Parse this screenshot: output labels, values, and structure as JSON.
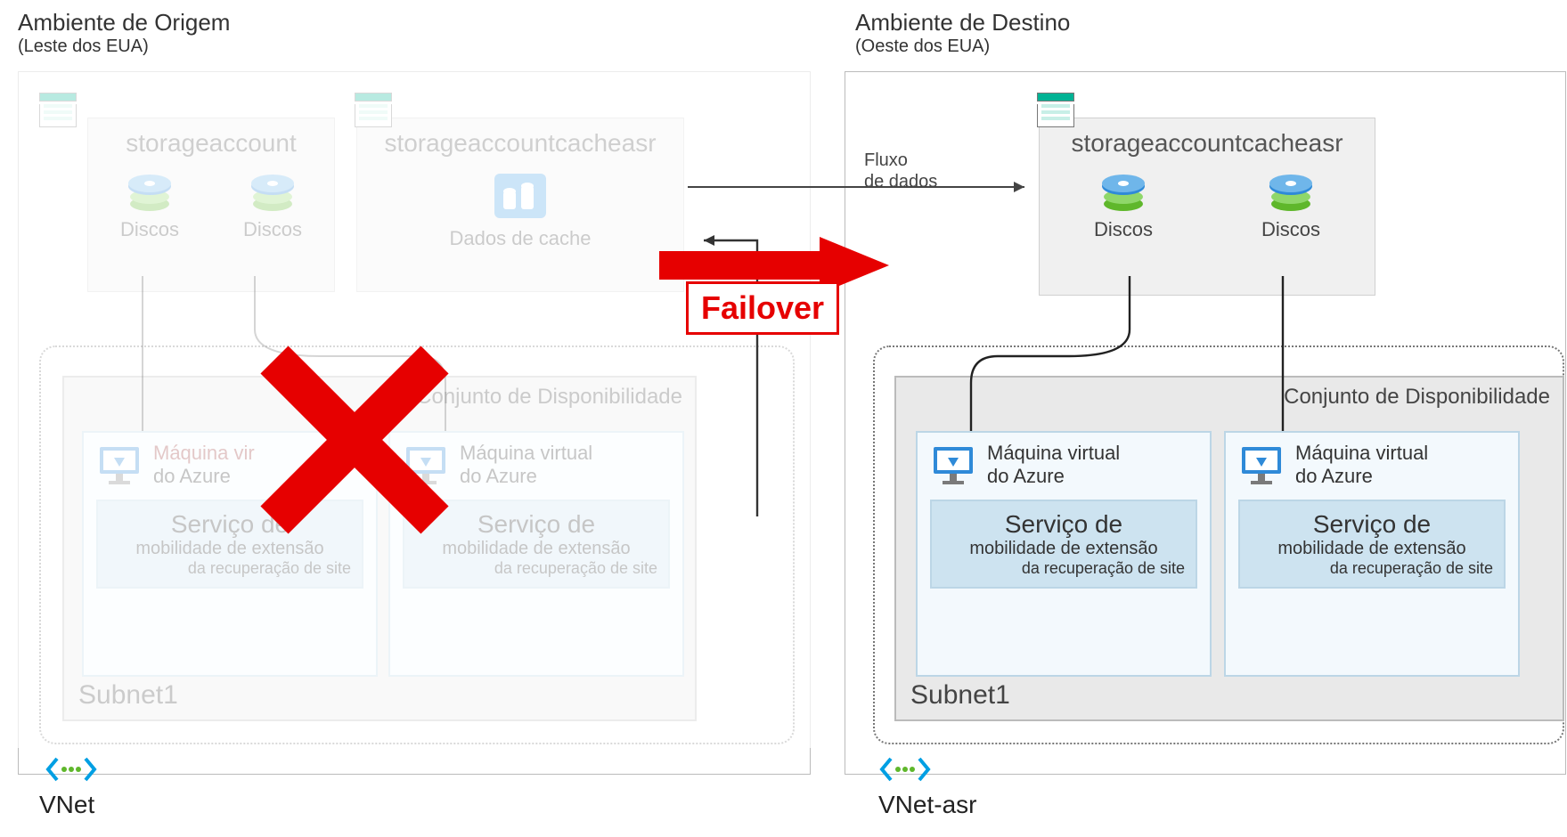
{
  "source": {
    "title": "Ambiente de Origem",
    "subtitle": "(Leste dos EUA)",
    "storage1": {
      "title": "storageaccount",
      "disk_label": "Discos"
    },
    "storage2": {
      "title": "storageaccountcacheasr",
      "cache_label": "Dados de cache"
    },
    "vnet": {
      "label": "VNet",
      "availability_title": "Conjunto de Disponibilidade",
      "subnet_label": "Subnet1",
      "vm_title_line1": "Máquina virtual",
      "vm_title_line1_cut": "Máquina vir",
      "vm_title_line2": "do Azure",
      "service_line1": "Serviço de",
      "service_line2": "mobilidade de extensão",
      "service_line3": "da recuperação de site"
    }
  },
  "target": {
    "title": "Ambiente de Destino",
    "subtitle": "(Oeste dos EUA)",
    "storage": {
      "title": "storageaccountcacheasr",
      "disk_label": "Discos"
    },
    "vnet": {
      "label": "VNet-asr",
      "availability_title": "Conjunto de Disponibilidade",
      "subnet_label": "Subnet1",
      "vm_title_line1": "Máquina virtual",
      "vm_title_line2": "do Azure",
      "service_line1": "Serviço de",
      "service_line2": "mobilidade de extensão",
      "service_line3": "da recuperação de site"
    }
  },
  "flow": {
    "data_flow_line1": "Fluxo",
    "data_flow_line2": "de dados",
    "failover": "Failover"
  },
  "colors": {
    "red": "#e60000",
    "azure_blue": "#2f8ad8",
    "azure_green": "#5fb72b",
    "storage_teal": "#00b294"
  }
}
